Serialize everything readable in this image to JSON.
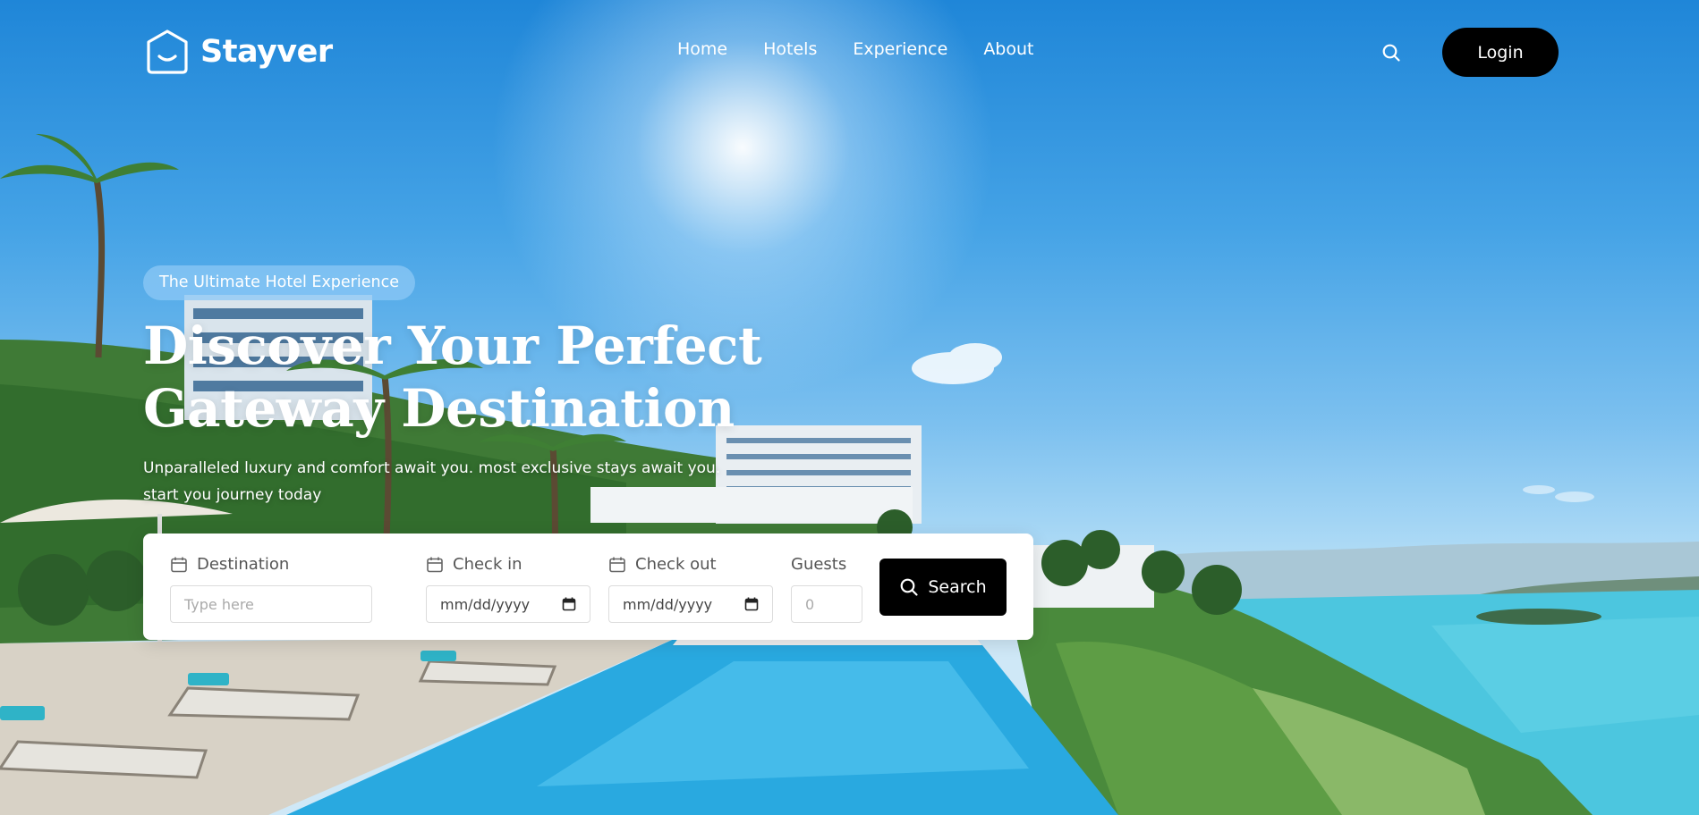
{
  "brand": {
    "name": "Stayver"
  },
  "nav": {
    "items": [
      {
        "label": "Home"
      },
      {
        "label": "Hotels"
      },
      {
        "label": "Experience"
      },
      {
        "label": "About"
      }
    ]
  },
  "header": {
    "login_label": "Login"
  },
  "hero": {
    "badge": "The Ultimate Hotel Experience",
    "title_line1": "Discover Your Perfect",
    "title_line2": "Gateway Destination",
    "subtitle": "Unparalleled luxury and comfort await you. most exclusive stays await you. start you journey today"
  },
  "search_form": {
    "destination": {
      "label": "Destination",
      "placeholder": "Type here"
    },
    "check_in": {
      "label": "Check in",
      "value": "mm/dd/yyyy"
    },
    "check_out": {
      "label": "Check out",
      "value": "mm/dd/yyyy"
    },
    "guests": {
      "label": "Guests",
      "placeholder": "0"
    },
    "submit_label": "Search"
  },
  "icons": {
    "logo": "house-smile-icon",
    "header_search": "search-icon",
    "calendar": "calendar-icon",
    "submit_search": "search-icon"
  },
  "colors": {
    "primary_button": "#000000",
    "badge_bg": "#8cc8f5",
    "text_on_image": "#ffffff"
  }
}
